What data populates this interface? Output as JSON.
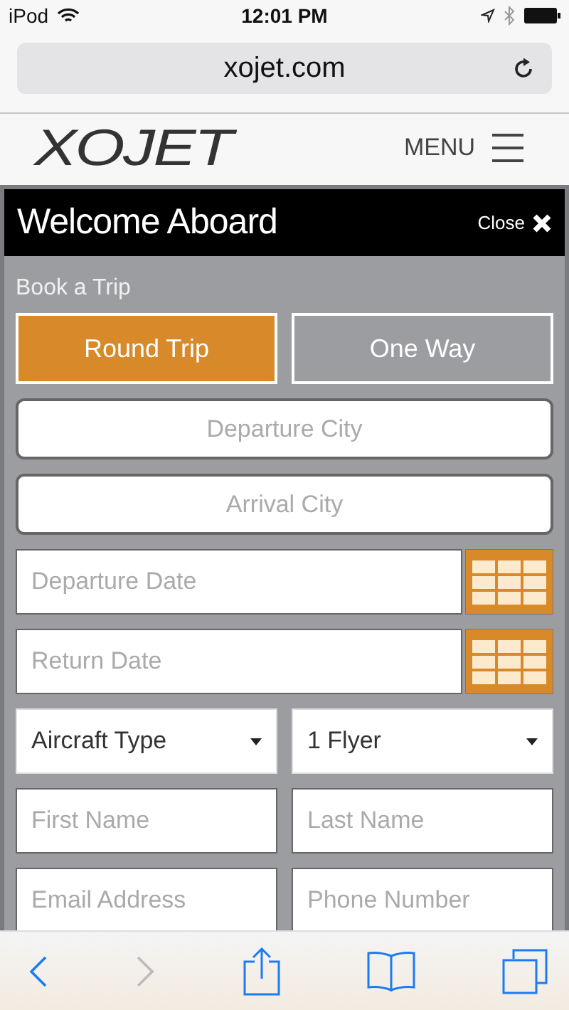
{
  "status_bar": {
    "carrier": "iPod",
    "time": "12:01 PM"
  },
  "browser": {
    "url": "xojet.com"
  },
  "header": {
    "logo": "XOJET",
    "menu": "MENU"
  },
  "panel": {
    "title": "Welcome Aboard",
    "close": "Close",
    "section": "Book a Trip",
    "trip_types": [
      {
        "label": "Round Trip",
        "selected": true
      },
      {
        "label": "One Way",
        "selected": false
      }
    ],
    "fields": [
      {
        "kind": "city",
        "placeholder": "Departure City"
      },
      {
        "kind": "city",
        "placeholder": "Arrival City"
      },
      {
        "kind": "date",
        "placeholder": "Departure Date"
      },
      {
        "kind": "date",
        "placeholder": "Return Date"
      },
      {
        "kind": "pair",
        "items": [
          {
            "kind": "select",
            "value": "Aircraft Type"
          },
          {
            "kind": "select",
            "value": "1 Flyer"
          }
        ]
      },
      {
        "kind": "pair",
        "items": [
          {
            "kind": "input",
            "placeholder": "First Name"
          },
          {
            "kind": "input",
            "placeholder": "Last Name"
          }
        ]
      },
      {
        "kind": "pair",
        "items": [
          {
            "kind": "input",
            "placeholder": "Email Address"
          },
          {
            "kind": "input",
            "placeholder": "Phone Number"
          }
        ]
      }
    ]
  },
  "toolbar": {
    "back_disabled": false,
    "forward_disabled": true
  }
}
